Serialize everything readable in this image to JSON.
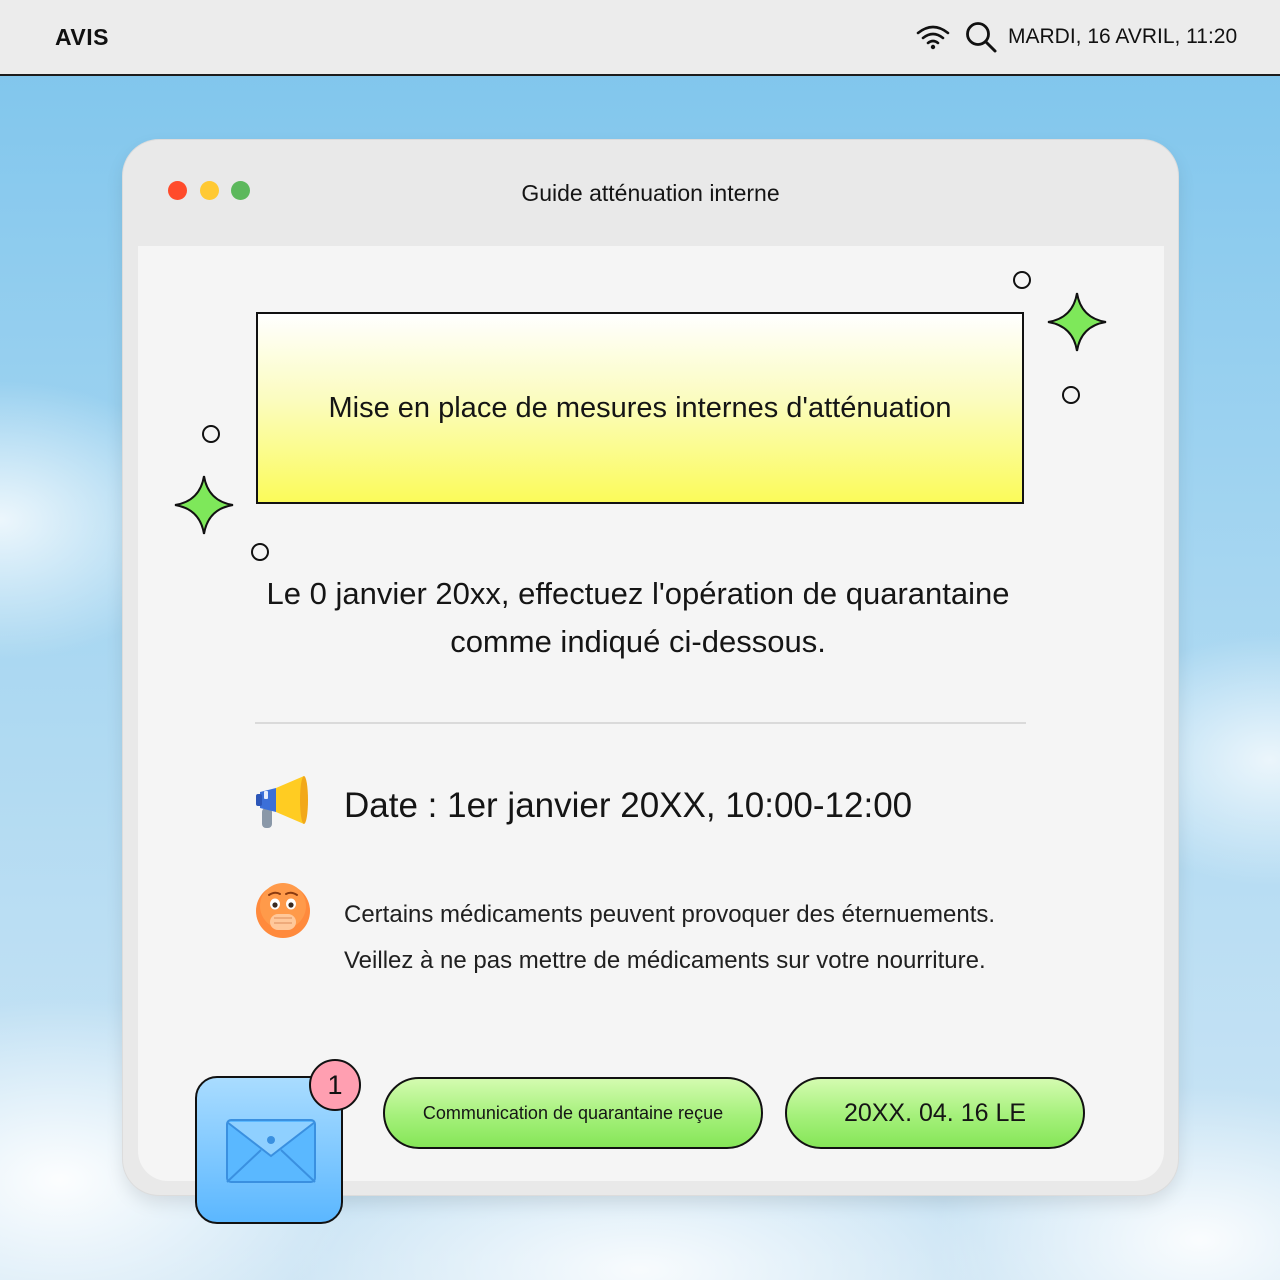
{
  "topbar": {
    "brand": "AVIS",
    "datetime": "MARDI, 16 AVRIL, 11:20",
    "icons": [
      "wifi-icon",
      "search-icon"
    ]
  },
  "window": {
    "title": "Guide atténuation interne",
    "controls": [
      "close",
      "minimize",
      "maximize"
    ]
  },
  "banner": {
    "text": "Mise en place de mesures internes d'atténuation"
  },
  "intro": {
    "line1": "Le 0 janvier 20xx, effectuez l'opération de quarantaine",
    "line2": "comme indiqué ci-dessous."
  },
  "details": {
    "date": "Date : 1er janvier 20XX, 10:00-12:00",
    "note_line1": "Certains médicaments peuvent provoquer des éternuements.",
    "note_line2": "Veillez à ne pas mettre de médicaments sur votre nourriture."
  },
  "footer": {
    "mail_badge": "1",
    "button1": "Communication de quarantaine reçue",
    "button2": "20XX. 04. 16 LE"
  },
  "colors": {
    "accent_green": "#86e658",
    "banner_yellow": "#fbfb5a",
    "mail_blue": "#5bb7ff",
    "badge_pink": "#ff9fb1"
  }
}
